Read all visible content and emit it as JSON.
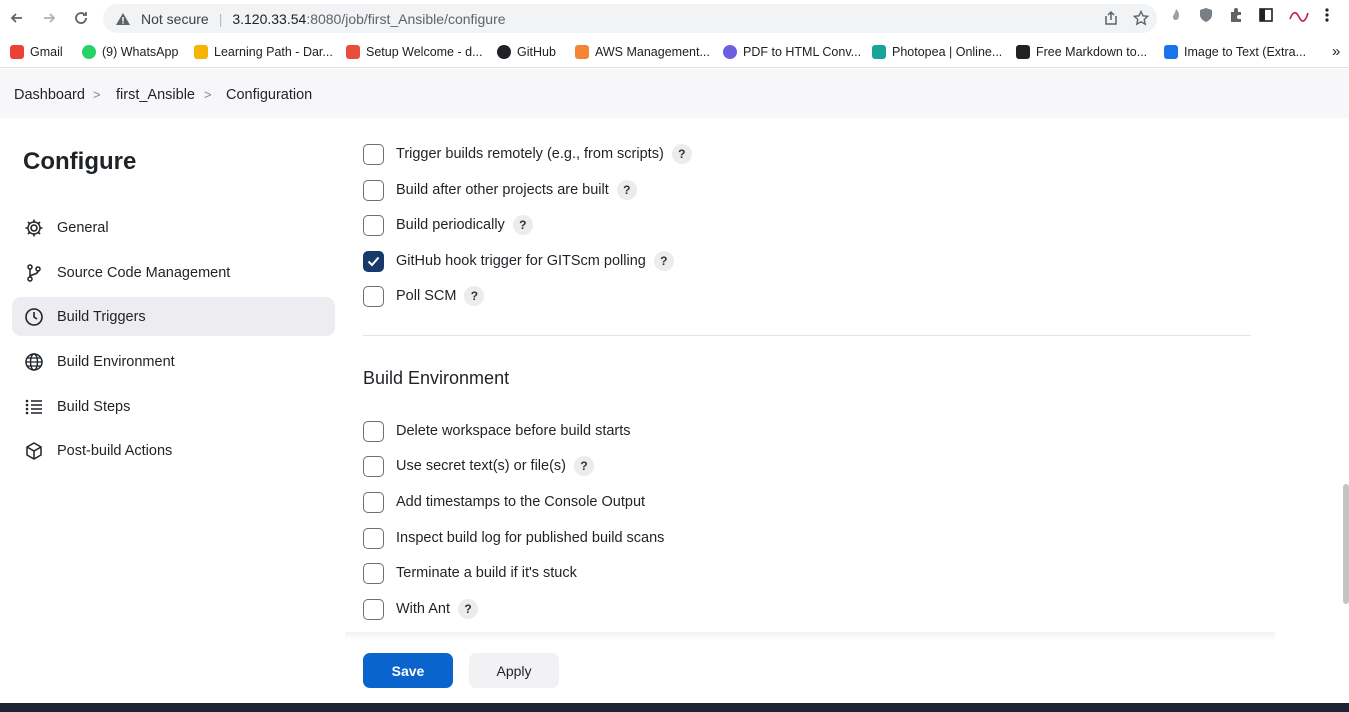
{
  "browser": {
    "security_label": "Not secure",
    "url_host": "3.120.33.54",
    "url_path": ":8080/job/first_Ansible/configure"
  },
  "bookmarks": [
    {
      "label": "Gmail",
      "color": "#ea4335"
    },
    {
      "label": "(9) WhatsApp",
      "color": "#25d366"
    },
    {
      "label": "Learning Path - Dar...",
      "color": "#f4b400"
    },
    {
      "label": "Setup Welcome - d...",
      "color": "#e94e3d"
    },
    {
      "label": "GitHub",
      "color": "#202124"
    },
    {
      "label": "AWS Management...",
      "color": "#f58536"
    },
    {
      "label": "PDF to HTML Conv...",
      "color": "#6b5fe0"
    },
    {
      "label": "Photopea | Online...",
      "color": "#18a497"
    },
    {
      "label": "Free Markdown to...",
      "color": "#202124"
    },
    {
      "label": "Image to Text (Extra...",
      "color": "#1a73e8"
    }
  ],
  "breadcrumb": {
    "items": [
      "Dashboard",
      "first_Ansible",
      "Configuration"
    ]
  },
  "sidebar": {
    "title": "Configure",
    "items": [
      {
        "label": "General",
        "icon": "gear-icon"
      },
      {
        "label": "Source Code Management",
        "icon": "branch-icon"
      },
      {
        "label": "Build Triggers",
        "icon": "clock-icon",
        "active": true
      },
      {
        "label": "Build Environment",
        "icon": "globe-icon"
      },
      {
        "label": "Build Steps",
        "icon": "list-icon"
      },
      {
        "label": "Post-build Actions",
        "icon": "package-icon"
      }
    ]
  },
  "triggers": [
    {
      "label": "Trigger builds remotely (e.g., from scripts)",
      "checked": false,
      "help": true
    },
    {
      "label": "Build after other projects are built",
      "checked": false,
      "help": true
    },
    {
      "label": "Build periodically",
      "checked": false,
      "help": true
    },
    {
      "label": "GitHub hook trigger for GITScm polling",
      "checked": true,
      "help": true
    },
    {
      "label": "Poll SCM",
      "checked": false,
      "help": true
    }
  ],
  "build_environment": {
    "title": "Build Environment",
    "options": [
      {
        "label": "Delete workspace before build starts",
        "checked": false,
        "help": false
      },
      {
        "label": "Use secret text(s) or file(s)",
        "checked": false,
        "help": true
      },
      {
        "label": "Add timestamps to the Console Output",
        "checked": false,
        "help": false
      },
      {
        "label": "Inspect build log for published build scans",
        "checked": false,
        "help": false
      },
      {
        "label": "Terminate a build if it's stuck",
        "checked": false,
        "help": false
      },
      {
        "label": "With Ant",
        "checked": false,
        "help": true
      }
    ]
  },
  "actions": {
    "save_label": "Save",
    "apply_label": "Apply",
    "help_glyph": "?"
  },
  "colors": {
    "primary": "#0b63ce",
    "checked": "#173a6b"
  }
}
